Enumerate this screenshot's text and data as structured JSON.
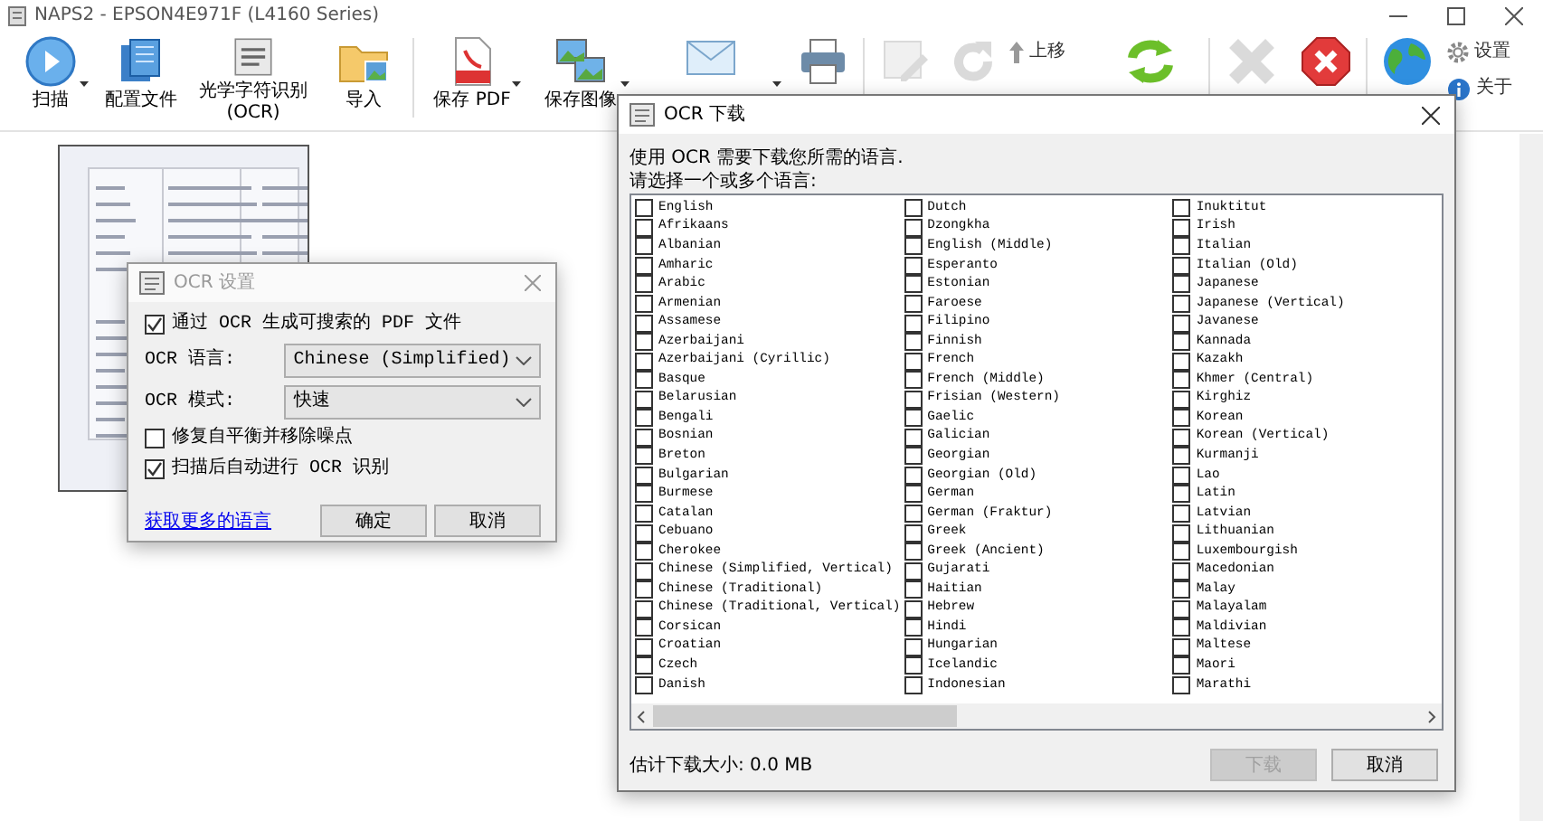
{
  "window": {
    "title": "NAPS2 - EPSON4E971F (L4160 Series)"
  },
  "toolbar": {
    "groups": [
      [
        {
          "kind": "scan",
          "label": "扫描",
          "dropdown": true,
          "disabled": false
        },
        {
          "kind": "profiles",
          "label": "配置文件",
          "dropdown": false,
          "disabled": false
        },
        {
          "kind": "ocr",
          "label": "光学字符识别 (OCR)",
          "dropdown": false,
          "disabled": false
        },
        {
          "kind": "import",
          "label": "导入",
          "dropdown": false,
          "disabled": false
        }
      ],
      [
        {
          "kind": "pdf",
          "label": "保存 PDF",
          "dropdown": true,
          "disabled": false
        },
        {
          "label": "保存图像",
          "dropdown": true,
          "disabled": false
        },
        {
          "kind": "email",
          "dropdown": true,
          "disabled": false
        },
        {
          "kind": "print",
          "dropdown": false,
          "disabled": false
        }
      ],
      [
        {
          "kind": "edit",
          "dropdown": false,
          "disabled": true
        },
        {
          "kind": "rotate",
          "dropdown": false,
          "disabled": true
        },
        {
          "kind": "moveup",
          "label": "上移",
          "dropdown": false,
          "disabled": false
        },
        {
          "kind": "refresh",
          "dropdown": false,
          "disabled": false
        }
      ],
      [
        {
          "kind": "delete",
          "dropdown": false,
          "disabled": true
        },
        {
          "kind": "clear",
          "dropdown": false,
          "disabled": false
        }
      ],
      [
        {
          "kind": "language",
          "dropdown": false,
          "disabled": false
        },
        {
          "kind": "settings",
          "label": "设置",
          "dropdown": false,
          "disabled": false
        },
        {
          "kind": "about",
          "label": "关于",
          "dropdown": false,
          "disabled": false
        }
      ]
    ]
  },
  "ocr_settings": {
    "title": "OCR 设置",
    "options": [
      {
        "kind": "check",
        "label": "通过 OCR 生成可搜索的 PDF 文件",
        "checked": true
      },
      {
        "kind": "select",
        "label": "OCR 语言:",
        "value": "Chinese (Simplified)"
      },
      {
        "kind": "select",
        "label": "OCR 模式:",
        "value": "快速"
      },
      {
        "kind": "check",
        "label": "修复自平衡并移除噪点",
        "checked": false
      },
      {
        "kind": "check",
        "label": "扫描后自动进行 OCR 识别",
        "checked": true
      }
    ],
    "link": "获取更多的语言",
    "buttons": [
      {
        "label": "确定"
      },
      {
        "label": "取消"
      }
    ]
  },
  "ocr_download": {
    "title": "OCR 下载",
    "message": "使用 OCR 需要下载您所需的语言.",
    "prompt": "请选择一个或多个语言:",
    "columns": [
      [
        {
          "label": "English",
          "checked": false
        },
        {
          "label": "Afrikaans",
          "checked": false
        },
        {
          "label": "Albanian",
          "checked": false
        },
        {
          "label": "Amharic",
          "checked": false
        },
        {
          "label": "Arabic",
          "checked": false
        },
        {
          "label": "Armenian",
          "checked": false
        },
        {
          "label": "Assamese",
          "checked": false
        },
        {
          "label": "Azerbaijani",
          "checked": false
        },
        {
          "label": "Azerbaijani (Cyrillic)",
          "checked": false
        },
        {
          "label": "Basque",
          "checked": false
        },
        {
          "label": "Belarusian",
          "checked": false
        },
        {
          "label": "Bengali",
          "checked": false
        },
        {
          "label": "Bosnian",
          "checked": false
        },
        {
          "label": "Breton",
          "checked": false
        },
        {
          "label": "Bulgarian",
          "checked": false
        },
        {
          "label": "Burmese",
          "checked": false
        },
        {
          "label": "Catalan",
          "checked": false
        },
        {
          "label": "Cebuano",
          "checked": false
        },
        {
          "label": "Cherokee",
          "checked": false
        },
        {
          "label": "Chinese (Simplified, Vertical)",
          "checked": false
        },
        {
          "label": "Chinese (Traditional)",
          "checked": false
        },
        {
          "label": "Chinese (Traditional, Vertical)",
          "checked": false
        },
        {
          "label": "Corsican",
          "checked": false
        },
        {
          "label": "Croatian",
          "checked": false
        },
        {
          "label": "Czech",
          "checked": false
        },
        {
          "label": "Danish",
          "checked": false
        }
      ],
      [
        {
          "label": "Dutch",
          "checked": false
        },
        {
          "label": "Dzongkha",
          "checked": false
        },
        {
          "label": "English (Middle)",
          "checked": false
        },
        {
          "label": "Esperanto",
          "checked": false
        },
        {
          "label": "Estonian",
          "checked": false
        },
        {
          "label": "Faroese",
          "checked": false
        },
        {
          "label": "Filipino",
          "checked": false
        },
        {
          "label": "Finnish",
          "checked": false
        },
        {
          "label": "French",
          "checked": false
        },
        {
          "label": "French (Middle)",
          "checked": false
        },
        {
          "label": "Frisian (Western)",
          "checked": false
        },
        {
          "label": "Gaelic",
          "checked": false
        },
        {
          "label": "Galician",
          "checked": false
        },
        {
          "label": "Georgian",
          "checked": false
        },
        {
          "label": "Georgian (Old)",
          "checked": false
        },
        {
          "label": "German",
          "checked": false
        },
        {
          "label": "German (Fraktur)",
          "checked": false
        },
        {
          "label": "Greek",
          "checked": false
        },
        {
          "label": "Greek (Ancient)",
          "checked": false
        },
        {
          "label": "Gujarati",
          "checked": false
        },
        {
          "label": "Haitian",
          "checked": false
        },
        {
          "label": "Hebrew",
          "checked": false
        },
        {
          "label": "Hindi",
          "checked": false
        },
        {
          "label": "Hungarian",
          "checked": false
        },
        {
          "label": "Icelandic",
          "checked": false
        },
        {
          "label": "Indonesian",
          "checked": false
        }
      ],
      [
        {
          "label": "Inuktitut",
          "checked": false
        },
        {
          "label": "Irish",
          "checked": false
        },
        {
          "label": "Italian",
          "checked": false
        },
        {
          "label": "Italian (Old)",
          "checked": false
        },
        {
          "label": "Japanese",
          "checked": false
        },
        {
          "label": "Japanese (Vertical)",
          "checked": false
        },
        {
          "label": "Javanese",
          "checked": false
        },
        {
          "label": "Kannada",
          "checked": false
        },
        {
          "label": "Kazakh",
          "checked": false
        },
        {
          "label": "Khmer (Central)",
          "checked": false
        },
        {
          "label": "Kirghiz",
          "checked": false
        },
        {
          "label": "Korean",
          "checked": false
        },
        {
          "label": "Korean (Vertical)",
          "checked": false
        },
        {
          "label": "Kurmanji",
          "checked": false
        },
        {
          "label": "Lao",
          "checked": false
        },
        {
          "label": "Latin",
          "checked": false
        },
        {
          "label": "Latvian",
          "checked": false
        },
        {
          "label": "Lithuanian",
          "checked": false
        },
        {
          "label": "Luxembourgish",
          "checked": false
        },
        {
          "label": "Macedonian",
          "checked": false
        },
        {
          "label": "Malay",
          "checked": false
        },
        {
          "label": "Malayalam",
          "checked": false
        },
        {
          "label": "Maldivian",
          "checked": false
        },
        {
          "label": "Maltese",
          "checked": false
        },
        {
          "label": "Maori",
          "checked": false
        },
        {
          "label": "Marathi",
          "checked": false
        }
      ]
    ],
    "size_label": "估计下载大小: 0.0 MB",
    "buttons": [
      {
        "label": "下载",
        "disabled": true
      },
      {
        "label": "取消",
        "disabled": false
      }
    ]
  }
}
